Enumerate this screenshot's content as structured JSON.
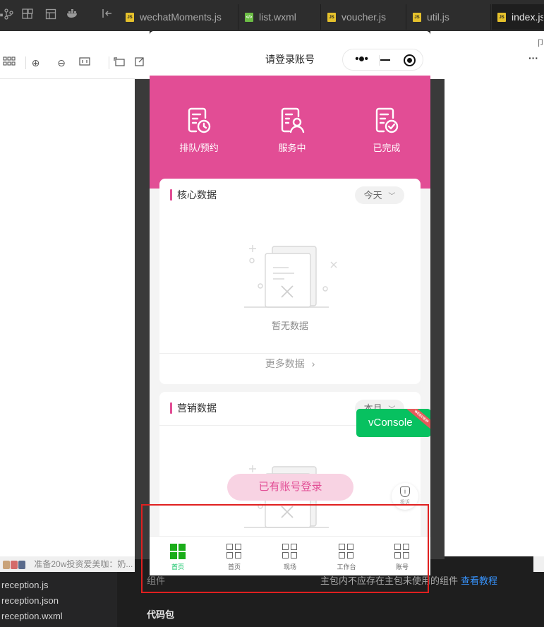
{
  "ide": {
    "toolbar_icons": [
      "branch-icon",
      "extensions-icon",
      "layout-icon",
      "docker-icon",
      "collapse-icon"
    ],
    "tabs": [
      {
        "label": "wechatMoments.js",
        "type": "js"
      },
      {
        "label": "list.wxml",
        "type": "wxml"
      },
      {
        "label": "voucher.js",
        "type": "js"
      },
      {
        "label": "util.js",
        "type": "js"
      },
      {
        "label": "index.js",
        "type": "js",
        "active": true
      }
    ],
    "simulator_tools": [
      "grid-icon",
      "zoom-in-icon",
      "zoom-out-icon",
      "fit-icon",
      "rotate-icon",
      "edit-icon"
    ],
    "more_label": "···",
    "pin_label": "卩",
    "status_text": "准备20w投资爱美咖：奶...",
    "files": [
      "reception.js",
      "reception.json",
      "reception.wxml"
    ],
    "bottom_panel": {
      "component_label": "组件",
      "note": "主包内不应存在主包未使用的组件",
      "link": "查看教程",
      "package_label": "代码包"
    }
  },
  "app": {
    "nav_title": "请登录账号",
    "capsule": {
      "more": "•●•"
    },
    "header_items": [
      {
        "label": "排队/预约",
        "icon": "queue-clock-icon"
      },
      {
        "label": "服务中",
        "icon": "service-user-icon"
      },
      {
        "label": "已完成",
        "icon": "completed-check-icon"
      }
    ],
    "core_card": {
      "title": "核心数据",
      "period": "今天",
      "empty_text": "暂无数据",
      "more_label": "更多数据"
    },
    "marketing_card": {
      "title": "营销数据",
      "period": "本月"
    },
    "vconsole": {
      "label": "vConsole",
      "ribbon": "WEBVIEW"
    },
    "login_button": "已有账号登录",
    "report_label": "投诉",
    "tabbar": [
      {
        "label": "首页",
        "active": true
      },
      {
        "label": "首页",
        "active": false
      },
      {
        "label": "现场",
        "active": false
      },
      {
        "label": "工作台",
        "active": false
      },
      {
        "label": "账号",
        "active": false
      }
    ],
    "colors": {
      "brand_pink": "#e24d95",
      "tab_active": "#1aad19",
      "vconsole_green": "#07c160"
    }
  }
}
